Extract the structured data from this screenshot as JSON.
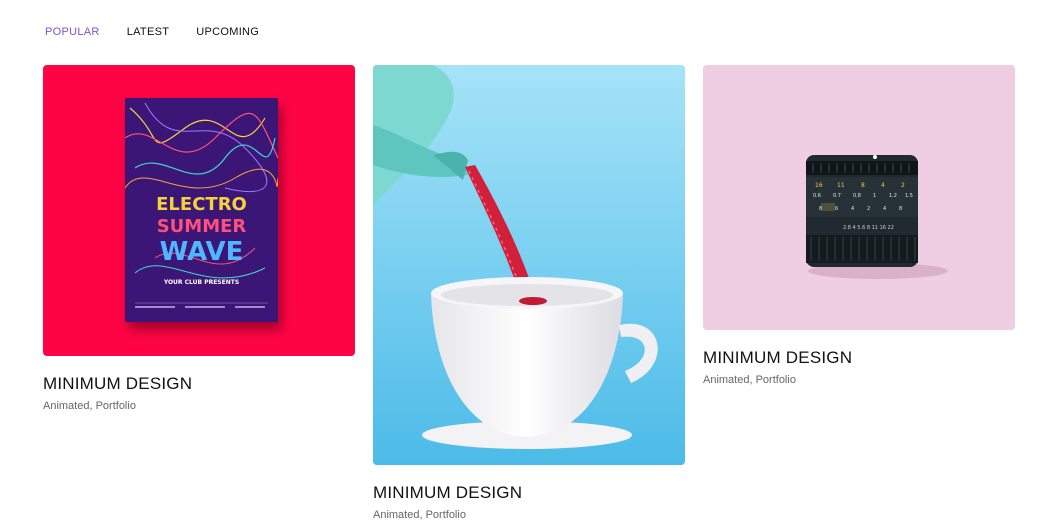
{
  "tabs": [
    {
      "label": "POPULAR",
      "active": true
    },
    {
      "label": "LATEST",
      "active": false
    },
    {
      "label": "UPCOMING",
      "active": false
    }
  ],
  "accent_color": "#7b55d1",
  "cards": [
    {
      "title": "MINIMUM DESIGN",
      "meta": "Animated, Portfolio",
      "image": "electro-summer-wave-poster",
      "bg_color": "#ff0444",
      "poster": {
        "lines": [
          "ELECTRO",
          "SUMMER",
          "WAVE"
        ],
        "sub": "YOUR CLUB PRESENTS"
      }
    },
    {
      "title": "MINIMUM DESIGN",
      "meta": "Animated, Portfolio",
      "image": "teapot-pouring-into-cup",
      "bg_color": "#62c8ef"
    },
    {
      "title": "MINIMUM DESIGN",
      "meta": "Animated, Portfolio",
      "image": "camera-lens",
      "bg_color": "#efcde2"
    }
  ]
}
